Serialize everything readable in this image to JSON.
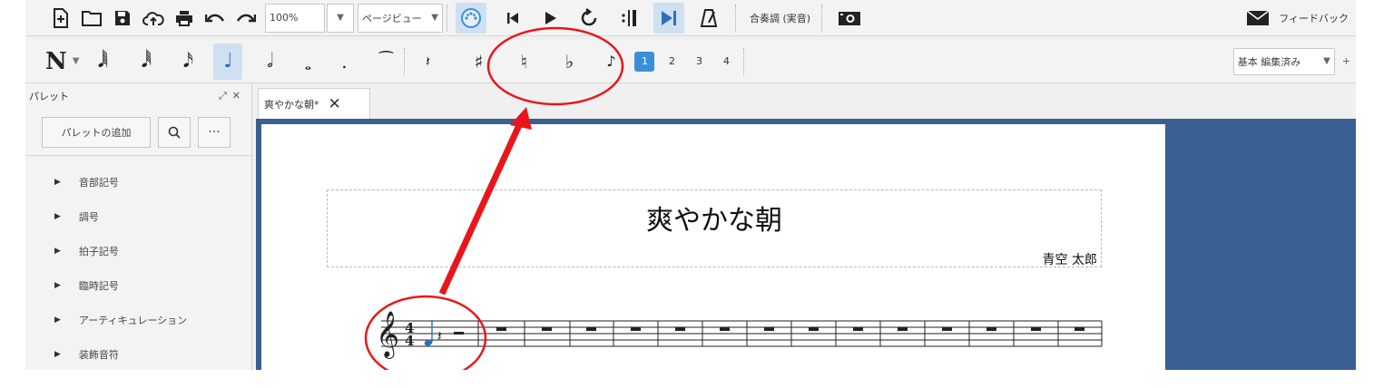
{
  "toolbar": {
    "zoom_value": "100%",
    "view_mode": "ページビュー",
    "concert_pitch": "合奏調 (実音)",
    "feedback": "フィードバック"
  },
  "note_input": {
    "mode_glyph": "N",
    "voices": [
      "1",
      "2",
      "3",
      "4"
    ],
    "workspace": "基本 編集済み",
    "add_workspace": "+"
  },
  "palette": {
    "title": "パレット",
    "add_button": "パレットの追加",
    "items": [
      "音部記号",
      "調号",
      "拍子記号",
      "臨時記号",
      "アーティキュレーション",
      "装飾音符"
    ]
  },
  "tab": {
    "label": "爽やかな朝*"
  },
  "score": {
    "title": "爽やかな朝",
    "composer": "青空 太郎"
  },
  "colors": {
    "score_background": "#3a5f92",
    "annotation_red": "#e8161b",
    "accent_blue": "#3a8fd8"
  }
}
